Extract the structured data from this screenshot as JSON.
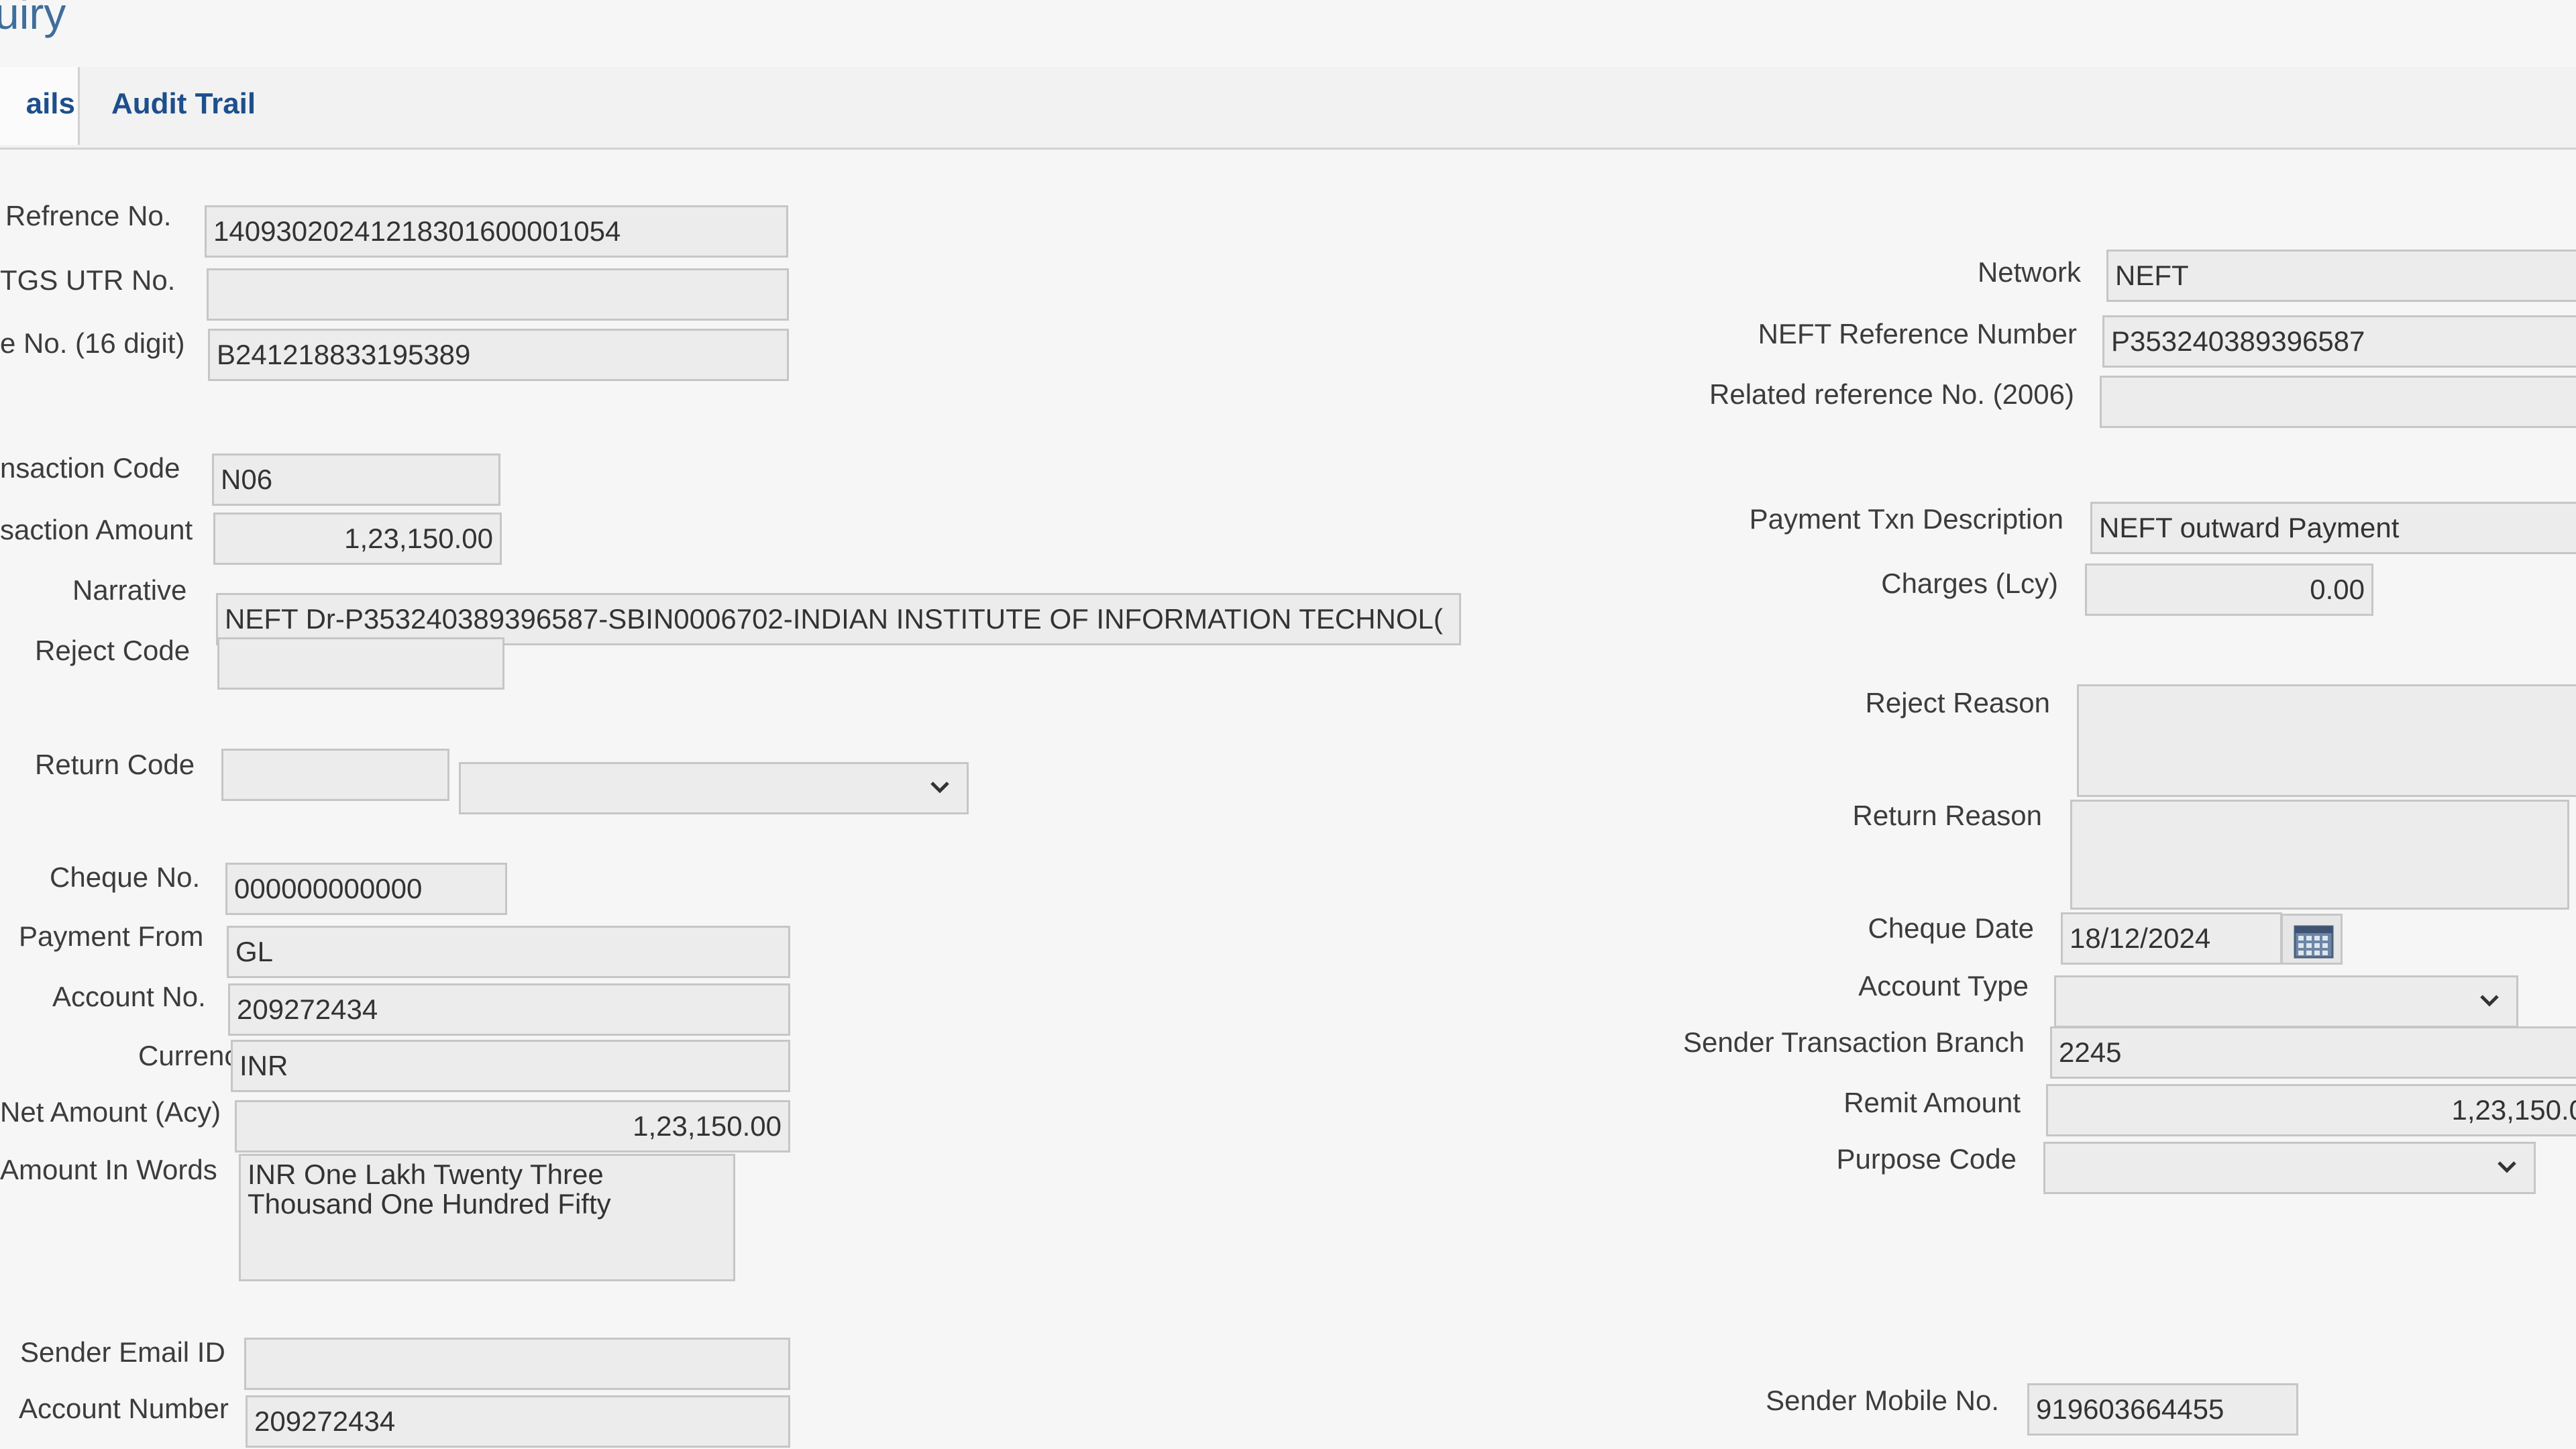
{
  "page": {
    "title": "uiry"
  },
  "tabs": {
    "details": "ails",
    "audit": "Audit Trail"
  },
  "left": {
    "ref_label": "Refrence No.",
    "ref_value": "14093020241218301600001054",
    "utr_label": "TGS UTR No.",
    "utr_value": "",
    "no16_label": "e No. (16 digit)",
    "no16_value": "B241218833195389",
    "txn_code_label": "nsaction Code",
    "txn_code_value": "N06",
    "txn_amount_label": "saction Amount",
    "txn_amount_value": "1,23,150.00",
    "narrative_label": "Narrative",
    "narrative_value": "NEFT Dr-P353240389396587-SBIN0006702-INDIAN INSTITUTE OF INFORMATION TECHNOL(",
    "reject_code_label": "Reject Code",
    "reject_code_value": "",
    "return_code_label": "Return Code",
    "return_code_value": "",
    "return_code_select": "",
    "cheque_no_label": "Cheque No.",
    "cheque_no_value": "000000000000",
    "payment_from_label": "Payment From",
    "payment_from_value": "GL",
    "account_no_label": "Account No.",
    "account_no_value": "209272434",
    "currency_label": "Currency",
    "currency_value": "INR",
    "net_amount_label": "Net Amount (Acy)",
    "net_amount_value": "1,23,150.00",
    "amount_words_label": "Amount In Words",
    "amount_words_value": "INR One Lakh Twenty Three Thousand One Hundred Fifty",
    "sender_email_label": "Sender Email ID",
    "sender_email_value": "",
    "account_number_label": "Account Number",
    "account_number_value": "209272434"
  },
  "right": {
    "network_label": "Network",
    "network_value": "NEFT",
    "neft_ref_label": "NEFT Reference Number",
    "neft_ref_value": "P353240389396587",
    "related_ref_label": "Related reference No. (2006)",
    "related_ref_value": "",
    "pay_desc_label": "Payment Txn Description",
    "pay_desc_value": "NEFT outward Payment",
    "charges_label": "Charges (Lcy)",
    "charges_value": "0.00",
    "reject_reason_label": "Reject Reason",
    "reject_reason_value": "",
    "return_reason_label": "Return Reason",
    "return_reason_value": "",
    "cheque_date_label": "Cheque Date",
    "cheque_date_value": "18/12/2024",
    "account_type_label": "Account Type",
    "account_type_value": "",
    "sender_branch_label": "Sender Transaction Branch",
    "sender_branch_value": "2245",
    "remit_amount_label": "Remit Amount",
    "remit_amount_value": "1,23,150.0",
    "purpose_code_label": "Purpose Code",
    "purpose_code_value": "",
    "sender_mobile_label": "Sender Mobile No.",
    "sender_mobile_value": "919603664455"
  }
}
